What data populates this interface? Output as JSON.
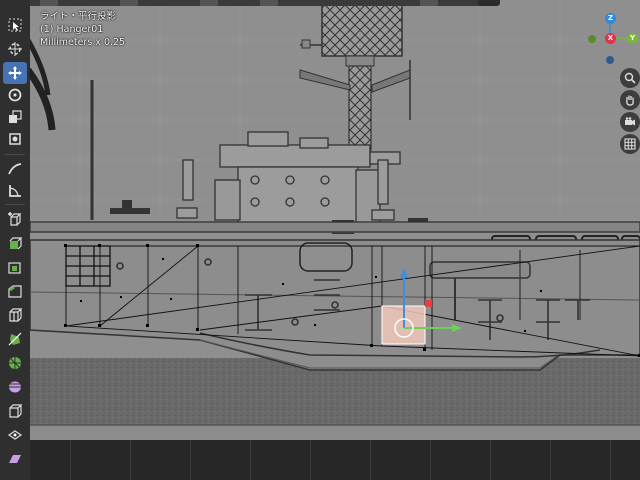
{
  "window": {
    "title": ""
  },
  "viewport": {
    "overlay": {
      "view_name": "ライト・平行投影",
      "object_name": "(1) Hanger01",
      "grid_scale": "Millimeters x 0.25"
    },
    "background_color": "#8f8f8f",
    "selection_color": "#f0c8b8"
  },
  "toolbar": {
    "tools": [
      {
        "name": "select-box",
        "icon": "select-box-icon",
        "active": false
      },
      {
        "name": "cursor",
        "icon": "cursor-icon",
        "active": false
      },
      {
        "name": "move",
        "icon": "move-icon",
        "active": true
      },
      {
        "name": "rotate",
        "icon": "rotate-icon",
        "active": false
      },
      {
        "name": "scale",
        "icon": "scale-icon",
        "active": false
      },
      {
        "name": "transform",
        "icon": "transform-icon",
        "active": false
      },
      {
        "name": "annotate",
        "icon": "annotate-icon",
        "active": false
      },
      {
        "name": "measure",
        "icon": "measure-icon",
        "active": false
      },
      {
        "name": "add-cube",
        "icon": "add-cube-icon",
        "active": false
      },
      {
        "name": "extrude",
        "icon": "extrude-icon",
        "active": false
      },
      {
        "name": "inset",
        "icon": "inset-icon",
        "active": false
      },
      {
        "name": "bevel",
        "icon": "bevel-icon",
        "active": false
      },
      {
        "name": "loop-cut",
        "icon": "loop-cut-icon",
        "active": false
      },
      {
        "name": "knife",
        "icon": "knife-icon",
        "active": false
      },
      {
        "name": "poly-build",
        "icon": "poly-build-icon",
        "active": false
      },
      {
        "name": "spin",
        "icon": "spin-icon",
        "active": false
      },
      {
        "name": "smooth",
        "icon": "smooth-icon",
        "active": false
      },
      {
        "name": "shrink-fatten",
        "icon": "shrink-fatten-icon",
        "active": false
      },
      {
        "name": "shear",
        "icon": "shear-icon",
        "active": false
      },
      {
        "name": "rip",
        "icon": "rip-icon",
        "active": false
      }
    ]
  },
  "navigation_gizmo": {
    "axes": {
      "x": "X",
      "y": "Y",
      "z": "Z"
    },
    "colors": {
      "x": "#e0334d",
      "y": "#7ab737",
      "z": "#2f8bd8",
      "neg_x": "#8b3340",
      "neg_y": "#5b8a2c",
      "neg_z": "#2e5d8c"
    },
    "buttons": [
      "zoom-icon",
      "hand-pan-icon",
      "camera-icon",
      "grid-toggle-icon"
    ]
  },
  "transform_gizmo": {
    "colors": {
      "x": "#e64040",
      "y": "#6dd05a",
      "z": "#3b8fe6"
    }
  }
}
